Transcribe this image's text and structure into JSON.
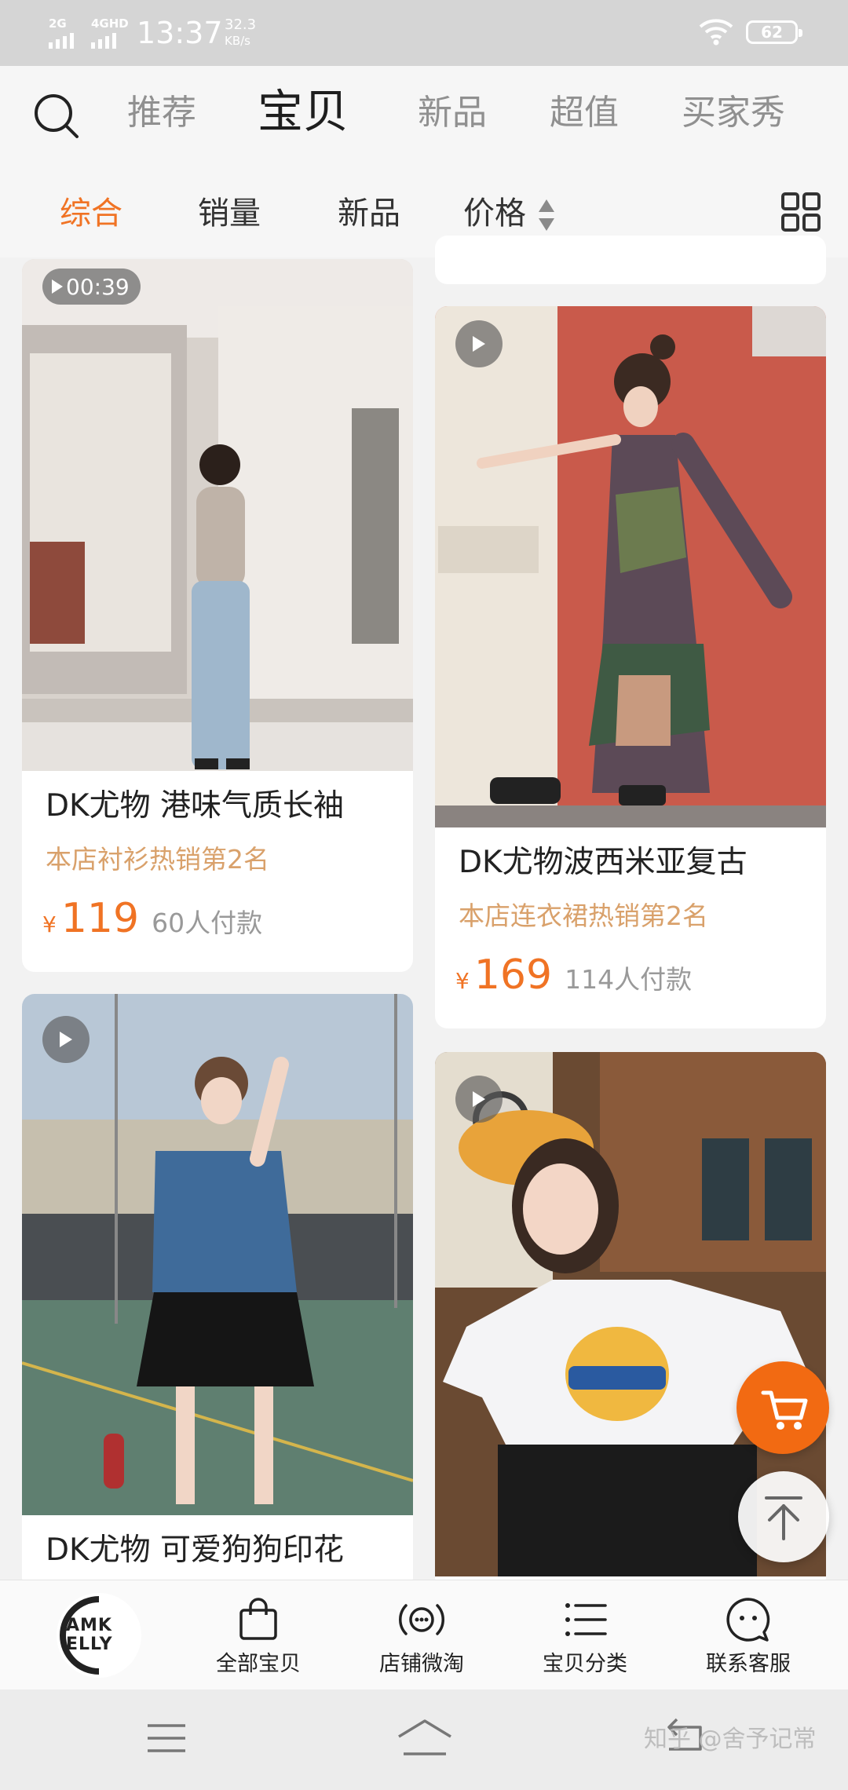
{
  "status_bar": {
    "sim1": "2G",
    "sim2": "4GHD",
    "time": "13:37",
    "speed_value": "32.3",
    "speed_unit": "KB/s",
    "battery": "62"
  },
  "header": {
    "tabs": [
      {
        "label": "推荐",
        "active": false
      },
      {
        "label": "宝贝",
        "active": true
      },
      {
        "label": "新品",
        "active": false
      },
      {
        "label": "超值",
        "active": false
      },
      {
        "label": "买家秀",
        "active": false
      }
    ]
  },
  "sort": {
    "items": [
      {
        "label": "综合",
        "active": true
      },
      {
        "label": "销量",
        "active": false
      },
      {
        "label": "新品",
        "active": false
      },
      {
        "label": "价格",
        "active": false
      }
    ]
  },
  "products": [
    {
      "name": "DK尤物 港味气质长袖",
      "rank": "本店衬衫热销第2名",
      "currency": "¥",
      "price": "119",
      "paid": "60人付款",
      "video_duration": "00:39"
    },
    {
      "name": "DK尤物波西米亚复古",
      "rank": "本店连衣裙热销第2名",
      "currency": "¥",
      "price": "169",
      "paid": "114人付款"
    },
    {
      "name": "DK尤物 可爱狗狗印花"
    },
    {
      "name": ""
    }
  ],
  "shop": {
    "logo_text": "AMK ELLY",
    "items": [
      {
        "label": "全部宝贝",
        "icon": "bag-icon"
      },
      {
        "label": "店铺微淘",
        "icon": "broadcast-icon"
      },
      {
        "label": "宝贝分类",
        "icon": "list-icon"
      },
      {
        "label": "联系客服",
        "icon": "chat-face-icon"
      }
    ]
  },
  "watermark": "知乎 @舍予记常",
  "colors": {
    "accent": "#f07324",
    "rank": "#d9a16b",
    "cart": "#f26a12"
  }
}
